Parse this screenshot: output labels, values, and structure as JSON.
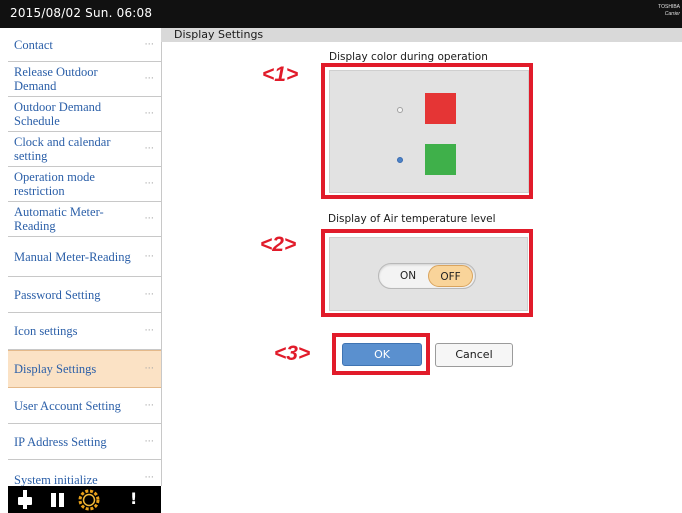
{
  "header": {
    "datetime": "2015/08/02 Sun. 06:08",
    "brand_line1": "TOSHIBA",
    "brand_line2": "Carrier"
  },
  "sidebar": {
    "items": [
      {
        "label": "Contact",
        "dots": "···",
        "active": false
      },
      {
        "label": "Release Outdoor Demand",
        "dots": "···",
        "active": false
      },
      {
        "label": "Outdoor Demand Schedule",
        "dots": "···",
        "active": false
      },
      {
        "label": "Clock and calendar setting",
        "dots": "···",
        "active": false
      },
      {
        "label": "Operation mode restriction",
        "dots": "···",
        "active": false
      },
      {
        "label": "Automatic Meter-Reading",
        "dots": "···",
        "active": false
      },
      {
        "label": "Manual Meter-Reading",
        "dots": "···",
        "active": false
      },
      {
        "label": "Password Setting",
        "dots": "···",
        "active": false
      },
      {
        "label": "Icon settings",
        "dots": "···",
        "active": false
      },
      {
        "label": "Display Settings",
        "dots": "···",
        "active": true
      },
      {
        "label": "User Account Setting",
        "dots": "···",
        "active": false
      },
      {
        "label": "IP Address Setting",
        "dots": "···",
        "active": false
      },
      {
        "label": "System initialize",
        "dots": "···",
        "active": false
      }
    ]
  },
  "bottombar": {
    "icons": [
      "power-plug-icon",
      "pause-icon",
      "gear-icon",
      "exclamation-icon"
    ],
    "exclamation": "!"
  },
  "main": {
    "section_title": "Display Settings",
    "color_section_label": "Display color during operation",
    "color_options": [
      {
        "color": "#e53535",
        "selected": false
      },
      {
        "color": "#3fb04a",
        "selected": true
      }
    ],
    "temp_section_label": "Display of Air temperature level",
    "toggle": {
      "on_label": "ON",
      "off_label": "OFF",
      "value": "OFF"
    },
    "ok_label": "OK",
    "cancel_label": "Cancel"
  },
  "annotations": {
    "marker1": "<1>",
    "marker2": "<2>",
    "marker3": "<3>",
    "color": "#e11b2a"
  }
}
